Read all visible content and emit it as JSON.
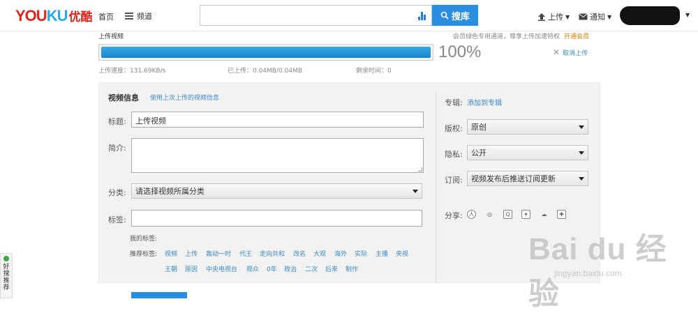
{
  "header": {
    "logo_latin_1": "YOU",
    "logo_latin_2": "KU",
    "logo_cn": "优酷",
    "nav_home": "首页",
    "nav_channel": "频道",
    "search_value": "",
    "search_button": "搜库",
    "upload_menu": "上传",
    "notice_menu": "通知"
  },
  "upload": {
    "title": "上传视频",
    "vip_text": "会员绿色专用通道，尊享上传加速特权",
    "vip_link": "开通会员",
    "progress": 1.0,
    "percent_text": "100%",
    "cancel": "取消上传",
    "speed_label": "上传速度：131.69KB/s",
    "uploaded_label": "已上传：0.04MB/0.04MB",
    "remaining_label": "剩余时间：0"
  },
  "info": {
    "section_title": "视频信息",
    "reuse_link": "使用上次上传的视频信息",
    "title_label": "标题:",
    "title_value": "上传视频",
    "desc_label": "简介:",
    "desc_value": "",
    "category_label": "分类:",
    "category_value": "请选择视频所属分类",
    "tags_label": "标签:",
    "tags_value": "",
    "my_tags_label": "我的标签:",
    "recommended_label": "推荐标签:",
    "recommended_tags": [
      "视频",
      "上传",
      "轰动一时",
      "代王",
      "走向共和",
      "改名",
      "大观",
      "海外",
      "实际",
      "主播",
      "央视",
      "王朝",
      "原因",
      "中央电视台",
      "观众",
      "0年",
      "政治",
      "二次",
      "后来",
      "制作"
    ]
  },
  "side": {
    "album_label": "专辑:",
    "album_link": "添加到专辑",
    "copyright_label": "版权:",
    "copyright_value": "原创",
    "privacy_label": "隐私:",
    "privacy_value": "公开",
    "subscribe_label": "订阅:",
    "subscribe_value": "视频发布后推送订阅更新",
    "share_label": "分享:",
    "share_icons": [
      "renren-icon",
      "weibo-icon",
      "qzone-icon",
      "tencent-weibo-icon",
      "douban-icon",
      "kaixin-icon"
    ]
  },
  "float_widget": {
    "text": "好搜推荐"
  },
  "watermark": {
    "main": "Bai du 经验",
    "sub": "jingyan.baidu.com"
  },
  "colors": {
    "accent": "#2a8ee0",
    "brand_red": "#e1251b",
    "link": "#3a8ac9",
    "vip": "#e07a00"
  }
}
